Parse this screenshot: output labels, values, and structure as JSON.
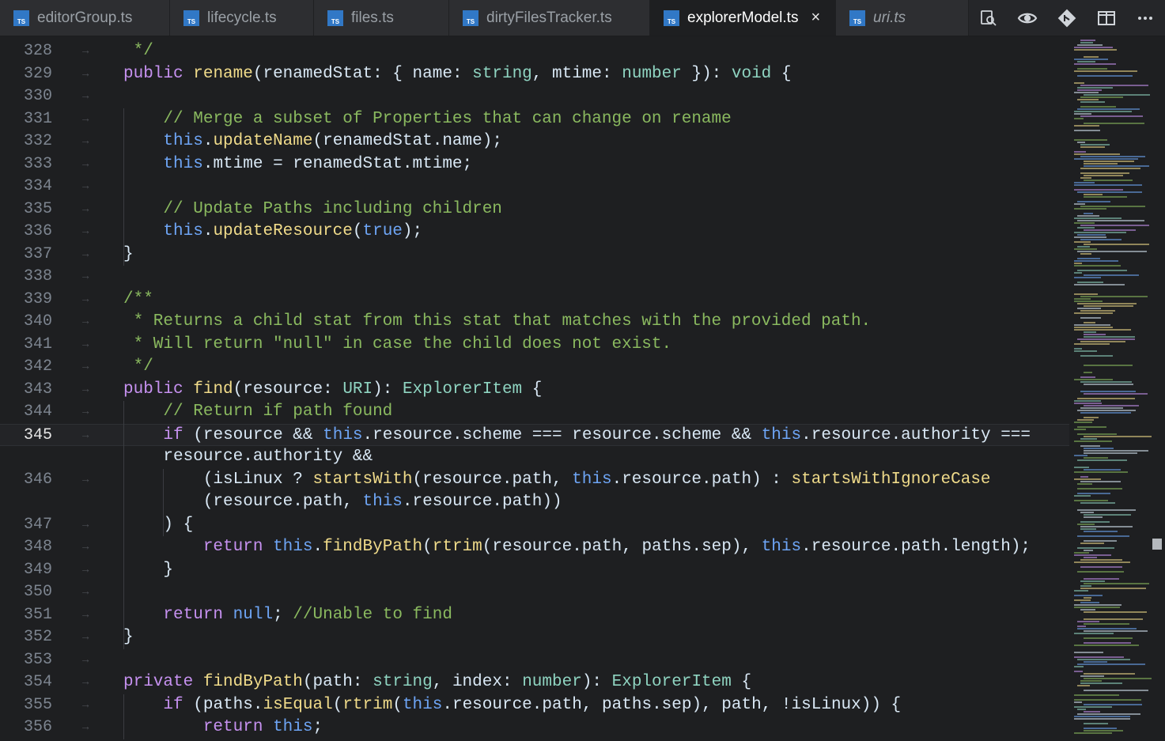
{
  "tabs": [
    {
      "label": "editorGroup.ts",
      "icon": "ts-file-icon",
      "active": false,
      "italic": false
    },
    {
      "label": "lifecycle.ts",
      "icon": "ts-file-icon",
      "active": false,
      "italic": false
    },
    {
      "label": "files.ts",
      "icon": "ts-file-icon",
      "active": false,
      "italic": false
    },
    {
      "label": "dirtyFilesTracker.ts",
      "icon": "ts-file-icon",
      "active": false,
      "italic": false
    },
    {
      "label": "explorerModel.ts",
      "icon": "ts-file-icon",
      "active": true,
      "italic": false
    },
    {
      "label": "uri.ts",
      "icon": "ts-file-icon",
      "active": false,
      "italic": true
    }
  ],
  "ts_badge": "TS",
  "close_glyph": "×",
  "toolbar": {
    "actions": [
      "find-references-icon",
      "preview-icon",
      "git-compare-icon",
      "split-editor-icon",
      "more-actions-icon"
    ]
  },
  "editor": {
    "current_line": 345,
    "line_numbers": [
      "328",
      "329",
      "330",
      "331",
      "332",
      "333",
      "334",
      "335",
      "336",
      "337",
      "338",
      "339",
      "340",
      "341",
      "342",
      "343",
      "344",
      "345",
      "",
      "346",
      "",
      "347",
      "348",
      "349",
      "350",
      "351",
      "352",
      "353",
      "354",
      "355",
      "356"
    ],
    "lines": [
      {
        "tokens": [
          [
            "cm",
            " */"
          ]
        ]
      },
      {
        "tokens": [
          [
            "kw",
            "public"
          ],
          [
            "pn",
            " "
          ],
          [
            "fn",
            "rename"
          ],
          [
            "pn",
            "("
          ],
          [
            "id",
            "renamedStat"
          ],
          [
            "pn",
            ": { "
          ],
          [
            "id",
            "name"
          ],
          [
            "pn",
            ": "
          ],
          [
            "ty",
            "string"
          ],
          [
            "pn",
            ", "
          ],
          [
            "id",
            "mtime"
          ],
          [
            "pn",
            ": "
          ],
          [
            "ty",
            "number"
          ],
          [
            "pn",
            " }): "
          ],
          [
            "ty",
            "void"
          ],
          [
            "pn",
            " {"
          ]
        ]
      },
      {
        "tokens": []
      },
      {
        "tokens": [
          [
            "pn",
            "    "
          ],
          [
            "cm",
            "// Merge a subset of Properties that can change on rename"
          ]
        ]
      },
      {
        "tokens": [
          [
            "pn",
            "    "
          ],
          [
            "th",
            "this"
          ],
          [
            "pn",
            "."
          ],
          [
            "fn",
            "updateName"
          ],
          [
            "pn",
            "("
          ],
          [
            "id",
            "renamedStat"
          ],
          [
            "pn",
            "."
          ],
          [
            "id",
            "name"
          ],
          [
            "pn",
            ");"
          ]
        ]
      },
      {
        "tokens": [
          [
            "pn",
            "    "
          ],
          [
            "th",
            "this"
          ],
          [
            "pn",
            "."
          ],
          [
            "id",
            "mtime"
          ],
          [
            "pn",
            " = "
          ],
          [
            "id",
            "renamedStat"
          ],
          [
            "pn",
            "."
          ],
          [
            "id",
            "mtime"
          ],
          [
            "pn",
            ";"
          ]
        ]
      },
      {
        "tokens": []
      },
      {
        "tokens": [
          [
            "pn",
            "    "
          ],
          [
            "cm",
            "// Update Paths including children"
          ]
        ]
      },
      {
        "tokens": [
          [
            "pn",
            "    "
          ],
          [
            "th",
            "this"
          ],
          [
            "pn",
            "."
          ],
          [
            "fn",
            "updateResource"
          ],
          [
            "pn",
            "("
          ],
          [
            "lit",
            "true"
          ],
          [
            "pn",
            ");"
          ]
        ]
      },
      {
        "tokens": [
          [
            "pn",
            "}"
          ]
        ]
      },
      {
        "tokens": []
      },
      {
        "tokens": [
          [
            "cm",
            "/**"
          ]
        ]
      },
      {
        "tokens": [
          [
            "cm",
            " * Returns a child stat from this stat that matches with the provided path."
          ]
        ]
      },
      {
        "tokens": [
          [
            "cm",
            " * Will return \"null\" in case the child does not exist."
          ]
        ]
      },
      {
        "tokens": [
          [
            "cm",
            " */"
          ]
        ]
      },
      {
        "tokens": [
          [
            "kw",
            "public"
          ],
          [
            "pn",
            " "
          ],
          [
            "fn",
            "find"
          ],
          [
            "pn",
            "("
          ],
          [
            "id",
            "resource"
          ],
          [
            "pn",
            ": "
          ],
          [
            "ty",
            "URI"
          ],
          [
            "pn",
            "): "
          ],
          [
            "ty",
            "ExplorerItem"
          ],
          [
            "pn",
            " {"
          ]
        ]
      },
      {
        "tokens": [
          [
            "pn",
            "    "
          ],
          [
            "cm",
            "// Return if path found"
          ]
        ]
      },
      {
        "tokens": [
          [
            "pn",
            "    "
          ],
          [
            "kw",
            "if"
          ],
          [
            "pn",
            " ("
          ],
          [
            "id",
            "resource"
          ],
          [
            "pn",
            " && "
          ],
          [
            "th",
            "this"
          ],
          [
            "pn",
            "."
          ],
          [
            "id",
            "resource"
          ],
          [
            "pn",
            "."
          ],
          [
            "id",
            "scheme"
          ],
          [
            "pn",
            " === "
          ],
          [
            "id",
            "resource"
          ],
          [
            "pn",
            "."
          ],
          [
            "id",
            "scheme"
          ],
          [
            "pn",
            " && "
          ],
          [
            "th",
            "this"
          ],
          [
            "pn",
            "."
          ],
          [
            "id",
            "resource"
          ],
          [
            "pn",
            "."
          ],
          [
            "id",
            "authority"
          ],
          [
            "pn",
            " ==="
          ]
        ]
      },
      {
        "tokens": [
          [
            "pn",
            "    "
          ],
          [
            "id",
            "resource"
          ],
          [
            "pn",
            "."
          ],
          [
            "id",
            "authority"
          ],
          [
            "pn",
            " &&"
          ]
        ]
      },
      {
        "tokens": [
          [
            "pn",
            "        ("
          ],
          [
            "id",
            "isLinux"
          ],
          [
            "pn",
            " ? "
          ],
          [
            "fn",
            "startsWith"
          ],
          [
            "pn",
            "("
          ],
          [
            "id",
            "resource"
          ],
          [
            "pn",
            "."
          ],
          [
            "id",
            "path"
          ],
          [
            "pn",
            ", "
          ],
          [
            "th",
            "this"
          ],
          [
            "pn",
            "."
          ],
          [
            "id",
            "resource"
          ],
          [
            "pn",
            "."
          ],
          [
            "id",
            "path"
          ],
          [
            "pn",
            ") : "
          ],
          [
            "fn",
            "startsWithIgnoreCase"
          ]
        ]
      },
      {
        "tokens": [
          [
            "pn",
            "        ("
          ],
          [
            "id",
            "resource"
          ],
          [
            "pn",
            "."
          ],
          [
            "id",
            "path"
          ],
          [
            "pn",
            ", "
          ],
          [
            "th",
            "this"
          ],
          [
            "pn",
            "."
          ],
          [
            "id",
            "resource"
          ],
          [
            "pn",
            "."
          ],
          [
            "id",
            "path"
          ],
          [
            "pn",
            "))"
          ]
        ]
      },
      {
        "tokens": [
          [
            "pn",
            "    ) {"
          ]
        ]
      },
      {
        "tokens": [
          [
            "pn",
            "        "
          ],
          [
            "kw",
            "return"
          ],
          [
            "pn",
            " "
          ],
          [
            "th",
            "this"
          ],
          [
            "pn",
            "."
          ],
          [
            "fn",
            "findByPath"
          ],
          [
            "pn",
            "("
          ],
          [
            "fn",
            "rtrim"
          ],
          [
            "pn",
            "("
          ],
          [
            "id",
            "resource"
          ],
          [
            "pn",
            "."
          ],
          [
            "id",
            "path"
          ],
          [
            "pn",
            ", "
          ],
          [
            "id",
            "paths"
          ],
          [
            "pn",
            "."
          ],
          [
            "id",
            "sep"
          ],
          [
            "pn",
            "), "
          ],
          [
            "th",
            "this"
          ],
          [
            "pn",
            "."
          ],
          [
            "id",
            "resource"
          ],
          [
            "pn",
            "."
          ],
          [
            "id",
            "path"
          ],
          [
            "pn",
            "."
          ],
          [
            "id",
            "length"
          ],
          [
            "pn",
            ");"
          ]
        ]
      },
      {
        "tokens": [
          [
            "pn",
            "    }"
          ]
        ]
      },
      {
        "tokens": []
      },
      {
        "tokens": [
          [
            "pn",
            "    "
          ],
          [
            "kw",
            "return"
          ],
          [
            "pn",
            " "
          ],
          [
            "lit",
            "null"
          ],
          [
            "pn",
            "; "
          ],
          [
            "cm",
            "//Unable to find"
          ]
        ]
      },
      {
        "tokens": [
          [
            "pn",
            "}"
          ]
        ]
      },
      {
        "tokens": []
      },
      {
        "tokens": [
          [
            "kw",
            "private"
          ],
          [
            "pn",
            " "
          ],
          [
            "fn",
            "findByPath"
          ],
          [
            "pn",
            "("
          ],
          [
            "id",
            "path"
          ],
          [
            "pn",
            ": "
          ],
          [
            "ty",
            "string"
          ],
          [
            "pn",
            ", "
          ],
          [
            "id",
            "index"
          ],
          [
            "pn",
            ": "
          ],
          [
            "ty",
            "number"
          ],
          [
            "pn",
            "): "
          ],
          [
            "ty",
            "ExplorerItem"
          ],
          [
            "pn",
            " {"
          ]
        ]
      },
      {
        "tokens": [
          [
            "pn",
            "    "
          ],
          [
            "kw",
            "if"
          ],
          [
            "pn",
            " ("
          ],
          [
            "id",
            "paths"
          ],
          [
            "pn",
            "."
          ],
          [
            "fn",
            "isEqual"
          ],
          [
            "pn",
            "("
          ],
          [
            "fn",
            "rtrim"
          ],
          [
            "pn",
            "("
          ],
          [
            "th",
            "this"
          ],
          [
            "pn",
            "."
          ],
          [
            "id",
            "resource"
          ],
          [
            "pn",
            "."
          ],
          [
            "id",
            "path"
          ],
          [
            "pn",
            ", "
          ],
          [
            "id",
            "paths"
          ],
          [
            "pn",
            "."
          ],
          [
            "id",
            "sep"
          ],
          [
            "pn",
            "), "
          ],
          [
            "id",
            "path"
          ],
          [
            "pn",
            ", !"
          ],
          [
            "id",
            "isLinux"
          ],
          [
            "pn",
            ")) {"
          ]
        ]
      },
      {
        "tokens": [
          [
            "pn",
            "        "
          ],
          [
            "kw",
            "return"
          ],
          [
            "pn",
            " "
          ],
          [
            "th",
            "this"
          ],
          [
            "pn",
            ";"
          ]
        ]
      }
    ]
  },
  "colors": {
    "background": "#1e1f21",
    "tab_active_bg": "#1e1f21",
    "tab_inactive_bg": "#2d2e31",
    "ts_icon": "#3178c6",
    "keyword": "#c691f0",
    "function": "#f0db8a",
    "type": "#8fd4c1",
    "this": "#6ea5f5",
    "comment": "#8ab95f"
  }
}
